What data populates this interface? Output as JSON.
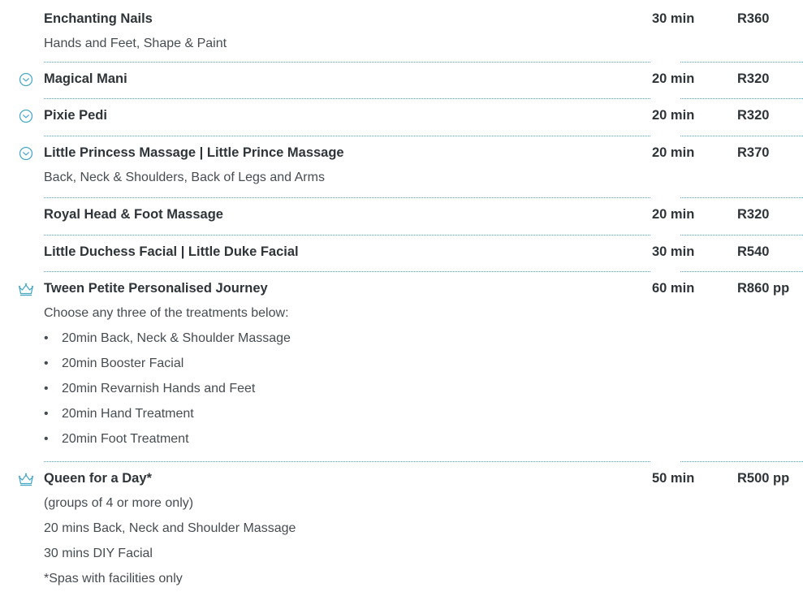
{
  "treatments": [
    {
      "icon": "",
      "name": "Enchanting Nails",
      "duration": "30 min",
      "price": "R360",
      "details": [
        "Hands and Feet, Shape & Paint"
      ],
      "bullets": [],
      "notes": []
    },
    {
      "icon": "clock-icon",
      "name": "Magical Mani",
      "duration": "20 min",
      "price": "R320",
      "details": [],
      "bullets": [],
      "notes": []
    },
    {
      "icon": "clock-icon",
      "name": "Pixie Pedi",
      "duration": "20 min",
      "price": "R320",
      "details": [],
      "bullets": [],
      "notes": []
    },
    {
      "icon": "clock-icon",
      "name": "Little Princess Massage  |  Little Prince Massage",
      "duration": "20 min",
      "price": "R370",
      "details": [
        "Back, Neck & Shoulders, Back of Legs and Arms"
      ],
      "bullets": [],
      "notes": []
    },
    {
      "icon": "",
      "name": "Royal Head & Foot Massage",
      "duration": "20 min",
      "price": "R320",
      "details": [],
      "bullets": [],
      "notes": []
    },
    {
      "icon": "",
      "name": "Little Duchess Facial  |  Little Duke Facial",
      "duration": "30 min",
      "price": "R540",
      "details": [],
      "bullets": [],
      "notes": []
    },
    {
      "icon": "crown-icon",
      "name": "Tween Petite Personalised Journey",
      "duration": "60 min",
      "price": "R860 pp",
      "details": [
        "Choose any three of the treatments below:"
      ],
      "bullets": [
        "20min Back, Neck & Shoulder Massage",
        "20min Booster Facial",
        "20min Revarnish Hands and Feet",
        "20min Hand Treatment",
        "20min Foot Treatment"
      ],
      "notes": []
    },
    {
      "icon": "crown-icon",
      "name": "Queen for a Day*",
      "duration": "50 min",
      "price": "R500 pp",
      "details": [
        "(groups of 4 or more only)",
        "20 mins Back, Neck and Shoulder Massage",
        "30 mins DIY Facial",
        "*Spas with facilities only"
      ],
      "bullets": [],
      "notes": []
    }
  ],
  "colors": {
    "accent": "#4aa8c8",
    "text": "#333a40"
  }
}
